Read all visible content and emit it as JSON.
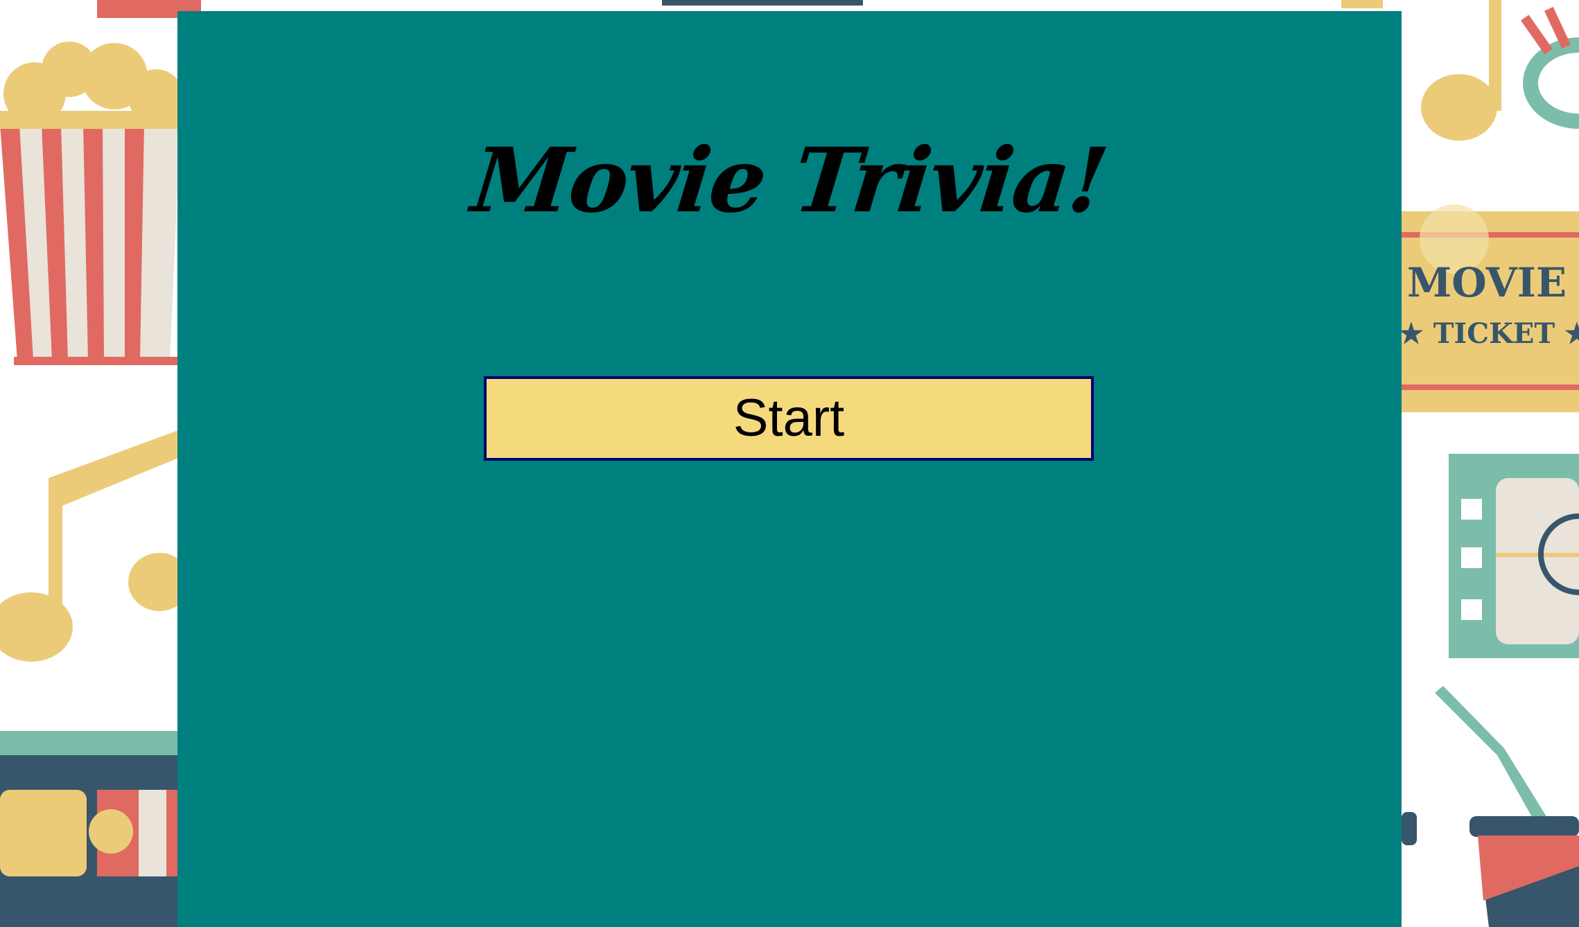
{
  "app": {
    "title": "Movie Trivia!",
    "start_label": "Start"
  },
  "background": {
    "ticket_line1": "MOVIE",
    "ticket_line2": "★ TICKET ★"
  },
  "colors": {
    "panel": "#007f7f",
    "button_fill": "#f5da7d",
    "button_border": "#00006e",
    "popcorn_red": "#e06a62",
    "popcorn_cream": "#e9e3da",
    "yellow": "#eccb78",
    "mint": "#7bbdaa",
    "slate": "#37566b"
  }
}
